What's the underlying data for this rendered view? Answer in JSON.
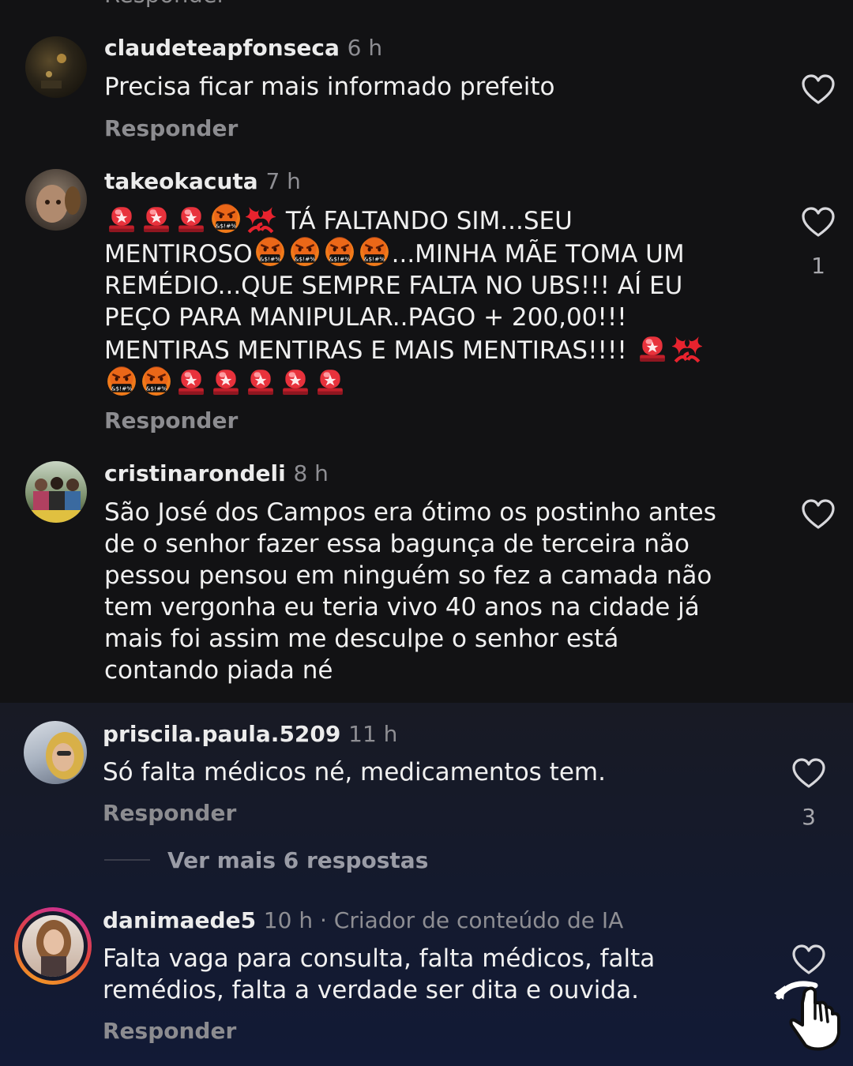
{
  "top_cut_reply": "Responder",
  "comments": [
    {
      "username": "claudeteapfonseca",
      "time": "6 h",
      "text": "Precisa ficar mais informado prefeito",
      "reply": "Responder"
    },
    {
      "username": "takeokacuta",
      "time": "7 h",
      "lines": [
        "TÁ FALTANDO SIM...SEU",
        "MENTIROSO",
        "...MINHA MÃE TOMA UM",
        "REMÉDIO...QUE SEMPRE FALTA NO UBS!!! AÍ EU",
        "PEÇO PARA MANIPULAR..PAGO + 200,00!!!",
        "MENTIRAS MENTIRAS E MAIS MENTIRAS!!!!"
      ],
      "likes": "1",
      "reply": "Responder"
    },
    {
      "username": "cristinarondeli",
      "time": "8 h",
      "lines": [
        "São José dos Campos era ótimo os postinho antes",
        "de o senhor fazer essa bagunça de terceira não",
        "pessou pensou em ninguém so fez a camada não",
        "tem vergonha eu teria vivo 40 anos na cidade já",
        "mais foi assim me desculpe o senhor está",
        "contando piada né"
      ]
    },
    {
      "username": "priscila.paula.5209",
      "time": "11 h",
      "text": "Só falta médicos né, medicamentos tem.",
      "reply": "Responder",
      "likes": "3",
      "more_replies": "Ver mais 6 respostas"
    },
    {
      "username": "danimaede5",
      "time": "10 h",
      "role": "Criador de conteúdo de IA",
      "lines": [
        "Falta vaga para consulta, falta médicos, falta",
        "remédios, falta a verdade ser dita e ouvida."
      ],
      "reply": "Responder"
    }
  ],
  "colors": {
    "background_top": "#121214",
    "background_bottom": "#141a2e",
    "story_ring_start": "#f5a623",
    "story_ring_end": "#c82ba5"
  },
  "icons": [
    "heart-icon",
    "siren-emoji",
    "cursing-face-emoji",
    "anger-symbol-emoji",
    "tap-gesture-icon"
  ]
}
